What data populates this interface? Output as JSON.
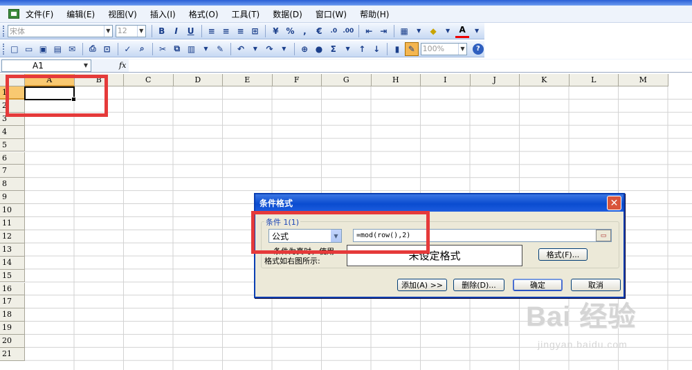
{
  "menus": [
    "文件(F)",
    "编辑(E)",
    "视图(V)",
    "插入(I)",
    "格式(O)",
    "工具(T)",
    "数据(D)",
    "窗口(W)",
    "帮助(H)"
  ],
  "toolbar1": {
    "font": "宋体",
    "size": "12",
    "bold": "B",
    "italic": "I",
    "underline": "U",
    "percent": "%",
    "comma": ",",
    "euro": "€",
    "font_color_label": "A"
  },
  "toolbar2": {
    "zoom": "100%",
    "sum": "Σ"
  },
  "namebox": "A1",
  "fx": "fx",
  "columns": [
    "A",
    "B",
    "C",
    "D",
    "E",
    "F",
    "G",
    "H",
    "I",
    "J",
    "K",
    "L",
    "M"
  ],
  "rows": [
    "1",
    "2",
    "3",
    "4",
    "5",
    "6",
    "7",
    "8",
    "9",
    "10",
    "11",
    "12",
    "13",
    "14",
    "15",
    "16",
    "17",
    "18",
    "19",
    "20",
    "21"
  ],
  "dialog": {
    "title": "条件格式",
    "group": "条件 1(1)",
    "condition_type": "公式",
    "formula": "=mod(row(),2)",
    "label_line1": "条件为真时，使用",
    "label_line2": "格式如右图所示:",
    "preview_text": "未设定格式",
    "format_btn": "格式(F)...",
    "add_btn": "添加(A) >>",
    "delete_btn": "删除(D)...",
    "ok_btn": "确定",
    "cancel_btn": "取消"
  },
  "watermark": {
    "main": "Bai 经验",
    "sub": "jingyan.baidu.com"
  },
  "colors": {
    "highlight_red": "#e53a3a",
    "dialog_title_blue": "#0a4cd0",
    "active_header": "#f9c971"
  }
}
